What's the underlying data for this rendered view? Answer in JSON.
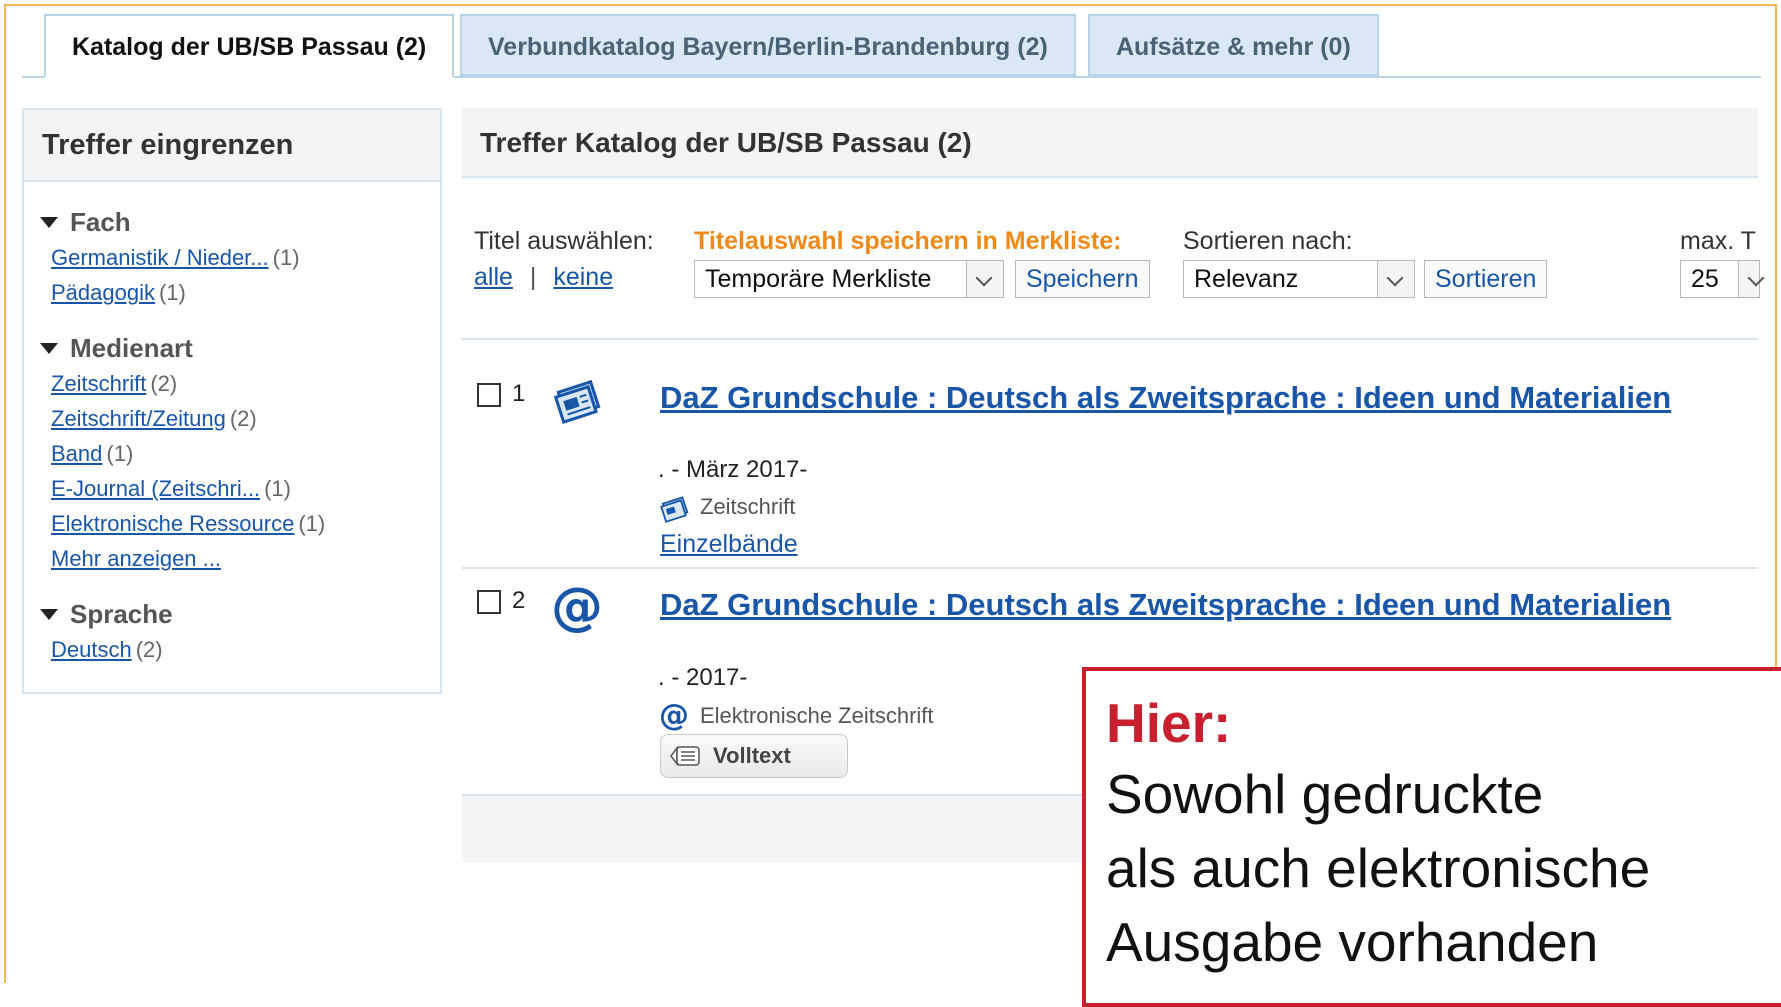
{
  "tabs": [
    {
      "label": "Katalog der UB/SB Passau (2)"
    },
    {
      "label": "Verbundkatalog Bayern/Berlin-Brandenburg (2)"
    },
    {
      "label": "Aufsätze & mehr (0)"
    }
  ],
  "sidebar": {
    "title": "Treffer eingrenzen",
    "facets": [
      {
        "title": "Fach",
        "items": [
          {
            "label": "Germanistik / Nieder...",
            "count": "(1)"
          },
          {
            "label": "Pädagogik",
            "count": "(1)"
          }
        ]
      },
      {
        "title": "Medienart",
        "items": [
          {
            "label": "Zeitschrift",
            "count": "(2)"
          },
          {
            "label": "Zeitschrift/Zeitung",
            "count": "(2)"
          },
          {
            "label": "Band",
            "count": "(1)"
          },
          {
            "label": "E-Journal (Zeitschri...",
            "count": "(1)"
          },
          {
            "label": "Elektronische Ressource",
            "count": "(1)"
          }
        ],
        "more": "Mehr anzeigen ..."
      },
      {
        "title": "Sprache",
        "items": [
          {
            "label": "Deutsch",
            "count": "(2)"
          }
        ]
      }
    ]
  },
  "main": {
    "title": "Treffer Katalog der UB/SB Passau (2)",
    "toolbar": {
      "select_label": "Titel auswählen:",
      "select_all": "alle",
      "separator": "|",
      "select_none": "keine",
      "save_label": "Titelauswahl speichern in Merkliste:",
      "save_select": "Temporäre Merkliste",
      "save_button": "Speichern",
      "sort_label": "Sortieren nach:",
      "sort_select": "Relevanz",
      "sort_button": "Sortieren",
      "max_label": "max. T",
      "max_select": "25"
    },
    "results": [
      {
        "num": "1",
        "title": "DaZ Grundschule : Deutsch als Zweitsprache : Ideen und Materialien",
        "date": ". - März 2017-",
        "type": "Zeitschrift",
        "link": "Einzelbände"
      },
      {
        "num": "2",
        "title": "DaZ Grundschule : Deutsch als Zweitsprache : Ideen und Materialien",
        "date": ". - 2017-",
        "type": "Elektronische Zeitschrift",
        "button": "Volltext",
        "icon_glyph": "@"
      }
    ]
  },
  "callout": {
    "head": "Hier:",
    "lines": [
      "Sowohl gedruckte",
      "als auch elektronische",
      "Ausgabe vorhanden"
    ]
  },
  "colors": {
    "link": "#1a56a8",
    "accent_orange": "#ef8a1a",
    "callout_red": "#c8202f",
    "frame": "#f2b84b"
  }
}
